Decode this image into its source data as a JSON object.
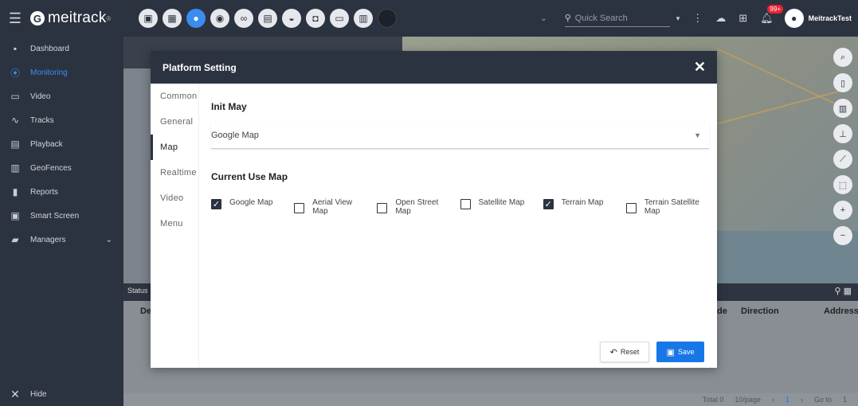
{
  "app": {
    "logo_text": "meitrack",
    "logo_mark": "®"
  },
  "topbar": {
    "search_placeholder": "Quick Search",
    "notification_count": "99+",
    "username": "MeitrackTest"
  },
  "sidebar": {
    "items": [
      {
        "label": "Dashboard",
        "icon": "dashboard-icon"
      },
      {
        "label": "Monitoring",
        "icon": "location-pin-icon"
      },
      {
        "label": "Video",
        "icon": "video-icon"
      },
      {
        "label": "Tracks",
        "icon": "tracks-icon"
      },
      {
        "label": "Playback",
        "icon": "playback-icon"
      },
      {
        "label": "GeoFences",
        "icon": "fence-icon"
      },
      {
        "label": "Reports",
        "icon": "bar-chart-icon"
      },
      {
        "label": "Smart Screen",
        "icon": "monitor-icon"
      },
      {
        "label": "Managers",
        "icon": "clipboard-icon"
      }
    ],
    "hide_label": "Hide"
  },
  "table": {
    "status_label": "Status",
    "col_de": "De",
    "col_direction": "Direction",
    "col_address": "Address",
    "col_de2": "de"
  },
  "pager": {
    "total": "Total 0",
    "per_page": "10/page",
    "page": "1",
    "goto": "Go to",
    "goto_value": "1"
  },
  "modal": {
    "title": "Platform Setting",
    "tabs": [
      "Common",
      "General",
      "Map",
      "Realtime",
      "Video",
      "Menu"
    ],
    "active_tab": "Map",
    "init_map_title": "Init May",
    "init_map_value": "Google Map",
    "current_map_title": "Current Use Map",
    "maps": [
      {
        "label": "Google Map",
        "checked": true
      },
      {
        "label": "Aerial View Map",
        "checked": false
      },
      {
        "label": "Open Street Map",
        "checked": false
      },
      {
        "label": "Satellite Map",
        "checked": false
      },
      {
        "label": "Terrain Map",
        "checked": true
      },
      {
        "label": "Terrain Satellite Map",
        "checked": false
      }
    ],
    "reset_label": "Reset",
    "save_label": "Save"
  },
  "colors": {
    "accent": "#3b8cf0",
    "header_bg": "#2b3340",
    "save_bg": "#1877e6"
  }
}
